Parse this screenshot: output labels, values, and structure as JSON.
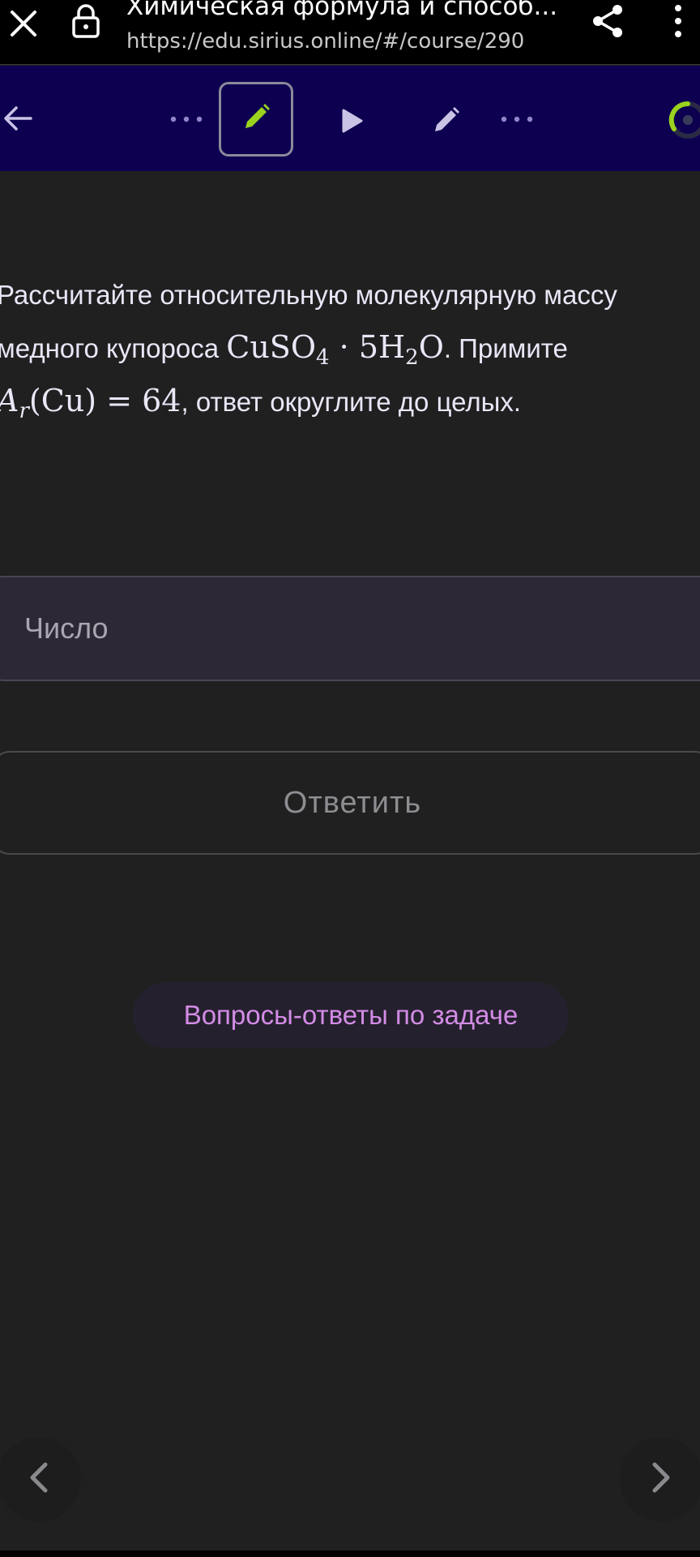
{
  "browser": {
    "page_title": "Химическая формула и способ...",
    "url": "https://edu.sirius.online/#/course/290",
    "icons": [
      "close-icon",
      "lock-icon",
      "share-icon",
      "more-vertical-icon"
    ]
  },
  "toolbar": {
    "back_icon": "arrow-left-icon",
    "steps": [
      {
        "icon": "more-horizontal-icon",
        "state": "collapsed"
      },
      {
        "icon": "pencil-icon",
        "state": "active",
        "color": "#9ad21e"
      },
      {
        "icon": "play-icon",
        "state": "inactive"
      },
      {
        "icon": "pencil-icon",
        "state": "inactive"
      },
      {
        "icon": "more-horizontal-icon",
        "state": "collapsed"
      }
    ],
    "progress_icon": "progress-ring-icon",
    "colors": {
      "background": "#0d0050",
      "accent": "#9ad21e"
    }
  },
  "question": {
    "line1": "Рассчитайте относительную молекулярную массу",
    "line2_text": "медного купороса",
    "formula": {
      "cu": "CuSO",
      "sub4": "4",
      "dot": "·",
      "water": "5H",
      "sub2": "2",
      "o": "O"
    },
    "line2_end": ". Примите",
    "line3_math": {
      "a": "A",
      "r": "r",
      "arg": "(Cu)",
      "eq": "=",
      "val": "64"
    },
    "line3_end": ", ответ округлите до целых."
  },
  "answer": {
    "placeholder": "Число",
    "value": ""
  },
  "submit_label": "Ответить",
  "qa_link_label": "Вопросы-ответы по задаче",
  "nav": {
    "prev_icon": "chevron-left-icon",
    "next_icon": "chevron-right-icon"
  },
  "colors": {
    "page_bg": "#202020",
    "text": "#e9e6f6",
    "link": "#d38ce6",
    "input_bg": "#2c2836"
  }
}
